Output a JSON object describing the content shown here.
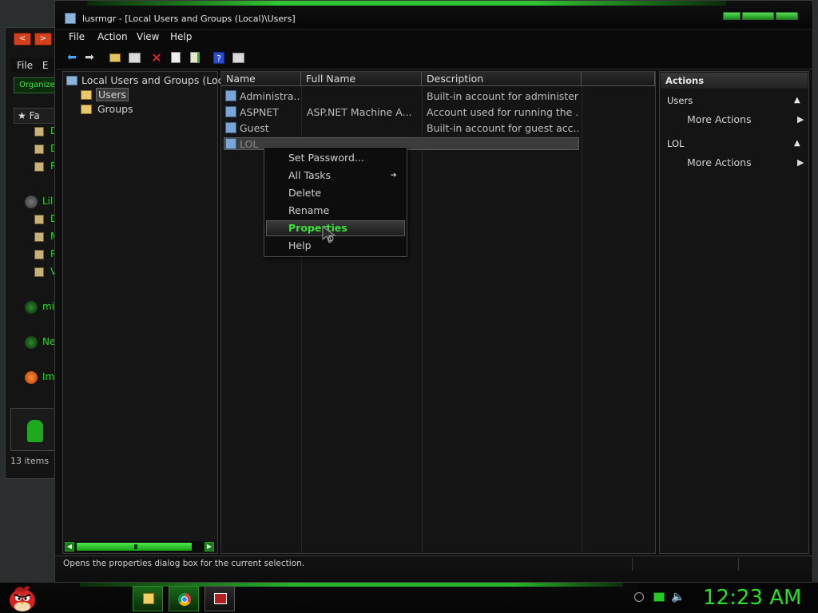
{
  "background_window": {
    "nav_back": "<",
    "nav_forward": ">",
    "menu": [
      "File",
      "E"
    ],
    "organize": "Organize",
    "favorites": "Fa",
    "items": [
      {
        "label": "D"
      },
      {
        "label": "D"
      },
      {
        "label": "R"
      },
      {
        "label": "Lil"
      },
      {
        "label": "D"
      },
      {
        "label": "M"
      },
      {
        "label": "P"
      },
      {
        "label": "V"
      },
      {
        "label": "mi"
      },
      {
        "label": "Ne"
      },
      {
        "label": "Im"
      }
    ],
    "status": "13 items"
  },
  "window": {
    "title": "lusrmgr - [Local Users and Groups (Local)\\Users]",
    "menu": [
      "File",
      "Action",
      "View",
      "Help"
    ],
    "toolbar_icons": [
      "back-arrow-icon",
      "forward-arrow-icon",
      "up-folder-icon",
      "show-hide-tree-icon",
      "delete-icon",
      "properties-icon",
      "export-list-icon",
      "help-icon",
      "show-hide-action-pane-icon"
    ]
  },
  "tree": {
    "root": "Local Users and Groups (Loc",
    "children": [
      {
        "label": "Users",
        "selected": true
      },
      {
        "label": "Groups",
        "selected": false
      }
    ]
  },
  "list": {
    "columns": [
      "Name",
      "Full Name",
      "Description",
      ""
    ],
    "rows": [
      {
        "name": "Administra...",
        "full_name": "",
        "description": "Built-in account for administer..."
      },
      {
        "name": "ASPNET",
        "full_name": "ASP.NET Machine A...",
        "description": "Account used for running the ..."
      },
      {
        "name": "Guest",
        "full_name": "",
        "description": "Built-in account for guest acc..."
      },
      {
        "name": "LOL",
        "full_name": "",
        "description": ""
      }
    ]
  },
  "context_menu": {
    "items": [
      "Set Password...",
      "All Tasks",
      "Delete",
      "Rename",
      "Properties",
      "Help"
    ],
    "highlighted": "Properties",
    "submenu_arrow": "➔"
  },
  "actions": {
    "header": "Actions",
    "sections": [
      {
        "title": "Users",
        "item": "More Actions"
      },
      {
        "title": "LOL",
        "item": "More Actions"
      }
    ]
  },
  "statusbar": {
    "text": "Opens the properties dialog box for the current selection."
  },
  "taskbar": {
    "clock": "12:23 AM",
    "apps": [
      "explorer-icon",
      "chrome-icon",
      "computer-management-icon"
    ]
  },
  "colors": {
    "accent_green": "#25e025",
    "window_bg": "#0e0e0e",
    "pane_bg": "#141414"
  }
}
